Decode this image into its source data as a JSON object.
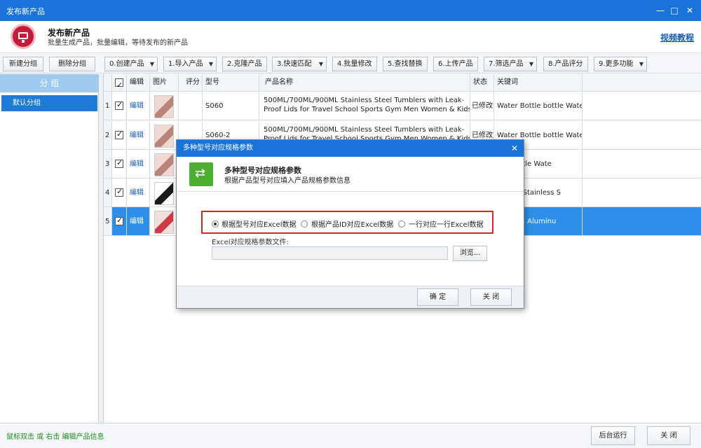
{
  "window": {
    "title": "发布新产品",
    "minimize": "—",
    "maximize": "□",
    "close": "✕"
  },
  "header": {
    "title": "发布新产品",
    "subtitle": "批量生成产品，批量编辑，等待发布的新产品",
    "link": "视频教程"
  },
  "toolbar": {
    "new_group": "新建分组",
    "delete_group": "删除分组",
    "buttons": [
      {
        "label": "0.创建产品",
        "dropdown": true
      },
      {
        "label": "1.导入产品",
        "dropdown": true
      },
      {
        "label": "2.克隆产品",
        "dropdown": false
      },
      {
        "label": "3.快速匹配",
        "dropdown": true
      },
      {
        "label": "4.批量修改",
        "dropdown": false
      },
      {
        "label": "5.查找替换",
        "dropdown": false
      },
      {
        "label": "6.上传产品",
        "dropdown": false
      },
      {
        "label": "7.筛选产品",
        "dropdown": true
      },
      {
        "label": "8.产品评分",
        "dropdown": false
      },
      {
        "label": "9.更多功能",
        "dropdown": true
      }
    ]
  },
  "sidebar": {
    "header": "分 组",
    "items": [
      "默认分组"
    ]
  },
  "grid": {
    "columns": [
      "编辑",
      "图片",
      "评分",
      "型号",
      "产品名称",
      "状态",
      "关键词"
    ],
    "rows": [
      {
        "num": "1",
        "edit": "编辑",
        "model": "S060",
        "name1": "500ML/700ML/900ML Stainless Steel Tumblers with Leak-",
        "name2": "Proof Lids for Travel School Sports Gym Men Women & Kids",
        "status": "已修改",
        "keyword": "Water Bottle bottle Wate"
      },
      {
        "num": "2",
        "edit": "编辑",
        "model": "S060-2",
        "name1": "500ML/700ML/900ML Stainless Steel Tumblers with Leak-",
        "name2": "Proof Lids for Travel School Sports Gym Men Women & Kids",
        "status": "已修改",
        "keyword": "Water Bottle bottle Wate"
      },
      {
        "num": "3",
        "edit": "编辑",
        "model": "",
        "name1": "",
        "name2": "",
        "status": "",
        "keyword": "ttle bottle Wate"
      },
      {
        "num": "4",
        "edit": "编辑",
        "model": "",
        "name1": "",
        "name2": "",
        "status": "",
        "keyword": "Walled Stainless S"
      },
      {
        "num": "5",
        "edit": "编辑",
        "model": "",
        "name1": "",
        "name2": "",
        "status": "",
        "keyword": "s 400ml Aluminu"
      }
    ]
  },
  "status": {
    "text": "鼠标双击 或 右击 编辑产品信息",
    "background": "后台运行",
    "close": "关 闭"
  },
  "dialog": {
    "title": "多种型号对应规格参数",
    "close": "✕",
    "head_title": "多种型号对应规格参数",
    "head_subtitle": "根据产品型号对应填入产品规格参数信息",
    "options": [
      "根据型号对应Excel数据",
      "根据产品ID对应Excel数据",
      "一行对应一行Excel数据"
    ],
    "selected_option": 0,
    "file_label": "Excel对应规格参数文件:",
    "file_value": "",
    "browse": "浏览...",
    "ok": "确 定",
    "cancel": "关 闭"
  },
  "colors": {
    "title_bar": "#1a73d9",
    "selected_row": "#2f8fe8",
    "highlight_box": "#d9232c",
    "dialog_icon": "#4daf2f"
  }
}
